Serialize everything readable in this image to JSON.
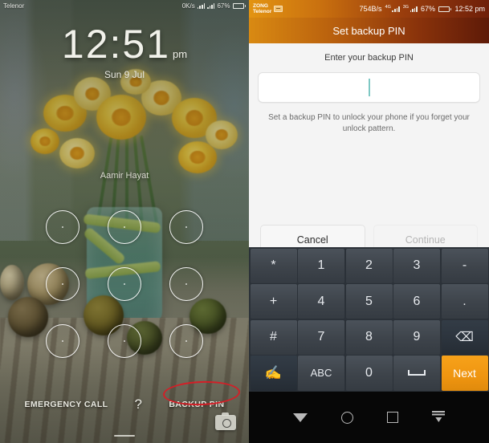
{
  "lock_screen": {
    "status_bar": {
      "carrier": "Telenor",
      "data_rate": "0K/s",
      "battery_percent": "67%",
      "signal_icon": "signal-bars-icon",
      "battery_icon": "battery-icon"
    },
    "clock": {
      "time": "12:51",
      "meridiem": "pm"
    },
    "date": "Sun 9 Jul",
    "owner_name": "Aamir Hayat",
    "pattern_lock": {
      "name": "pattern-lock-grid",
      "dots": 9
    },
    "bottom_actions": {
      "emergency_call": "EMERGENCY CALL",
      "help": "?",
      "backup_pin": "BACKUP PIN"
    },
    "camera_shortcut": "camera-icon",
    "annotation": {
      "shape": "ellipse",
      "color": "#d31f27",
      "targets": "BACKUP PIN"
    }
  },
  "pin_screen": {
    "status_bar": {
      "carrier_primary": "ZONG",
      "carrier_secondary": "Telenor",
      "sim_icon": "sim-card-icon",
      "data_rate": "754B/s",
      "network_1": "4G",
      "network_2": "3G",
      "battery_percent": "67%",
      "clock": "12:52 pm"
    },
    "header_title": "Set backup PIN",
    "field_label": "Enter your backup PIN",
    "pin_value": "",
    "pin_placeholder": "",
    "hint": "Set a backup PIN to unlock your phone if you forget your unlock pattern.",
    "buttons": {
      "cancel": "Cancel",
      "continue": "Continue",
      "continue_enabled": false
    },
    "keypad": {
      "rows": [
        [
          {
            "label": "*",
            "name": "key-asterisk",
            "style": "normal"
          },
          {
            "label": "1",
            "name": "key-1",
            "style": "normal"
          },
          {
            "label": "2",
            "name": "key-2",
            "style": "normal"
          },
          {
            "label": "3",
            "name": "key-3",
            "style": "normal"
          },
          {
            "label": "-",
            "name": "key-hyphen",
            "style": "normal"
          }
        ],
        [
          {
            "label": "+",
            "name": "key-plus",
            "style": "normal"
          },
          {
            "label": "4",
            "name": "key-4",
            "style": "normal"
          },
          {
            "label": "5",
            "name": "key-5",
            "style": "normal"
          },
          {
            "label": "6",
            "name": "key-6",
            "style": "normal"
          },
          {
            "label": ".",
            "name": "key-period",
            "style": "normal"
          }
        ],
        [
          {
            "label": "#",
            "name": "key-hash",
            "style": "normal"
          },
          {
            "label": "7",
            "name": "key-7",
            "style": "normal"
          },
          {
            "label": "8",
            "name": "key-8",
            "style": "normal"
          },
          {
            "label": "9",
            "name": "key-9",
            "style": "normal"
          },
          {
            "label": "⌫",
            "name": "key-backspace-icon",
            "style": "dark"
          }
        ],
        [
          {
            "label": "",
            "name": "key-handwriting-icon",
            "style": "dark"
          },
          {
            "label": "ABC",
            "name": "key-abc",
            "style": "small"
          },
          {
            "label": "0",
            "name": "key-0",
            "style": "normal"
          },
          {
            "label": "",
            "name": "key-space",
            "style": "normal"
          },
          {
            "label": "Next",
            "name": "key-next",
            "style": "accent"
          }
        ]
      ]
    },
    "nav_bar": {
      "back": "nav-back-icon",
      "home": "nav-home-icon",
      "recents": "nav-recents-icon",
      "hide_keyboard": "nav-hide-keyboard-icon"
    }
  },
  "colors": {
    "accent_orange": "#f7a21a",
    "header_gradient_start": "#d98a12",
    "header_gradient_end": "#5e1a08",
    "keypad_bg": "#2b3138",
    "annotation_red": "#d31f27",
    "caret_teal": "#7ec8c4"
  }
}
